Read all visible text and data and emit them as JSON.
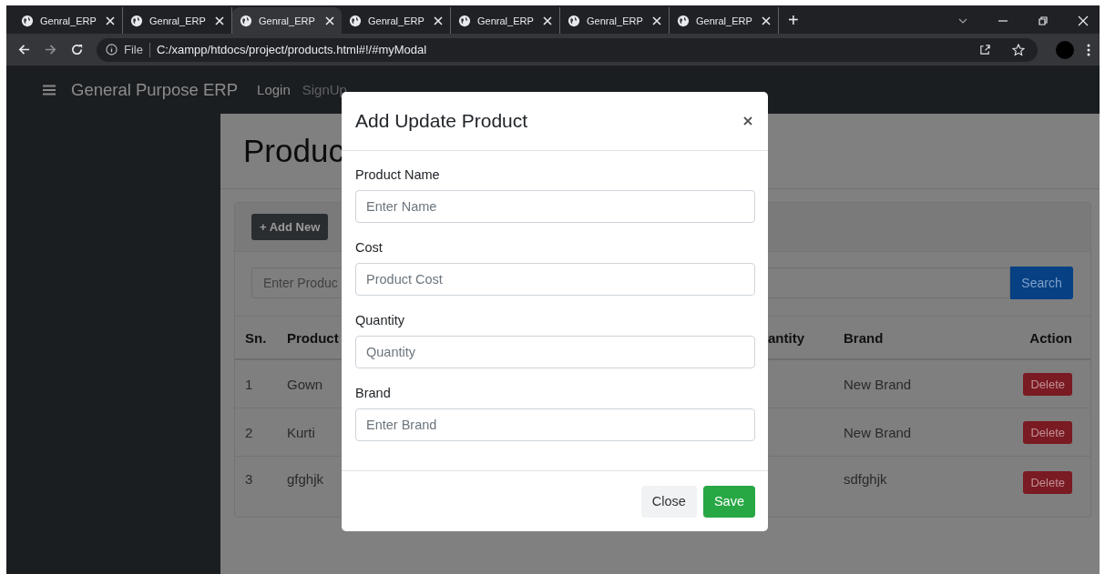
{
  "browser": {
    "tabs": [
      {
        "title": "Genral_ERP",
        "selected": false
      },
      {
        "title": "Genral_ERP",
        "selected": false
      },
      {
        "title": "Genral_ERP",
        "selected": true
      },
      {
        "title": "Genral_ERP",
        "selected": false
      },
      {
        "title": "Genral_ERP",
        "selected": false
      },
      {
        "title": "Genral_ERP",
        "selected": false
      },
      {
        "title": "Genral_ERP",
        "selected": false
      }
    ],
    "new_tab": "+",
    "address_bar": {
      "scheme": "File",
      "url": "C:/xampp/htdocs/project/products.html#!/#myModal"
    }
  },
  "navbar": {
    "brand": "General Purpose ERP",
    "links": [
      {
        "label": "Login",
        "active": true
      },
      {
        "label": "SignUp",
        "active": false
      }
    ]
  },
  "page": {
    "heading": "Produc",
    "add_button": "+ Add New",
    "search": {
      "placeholder": "Enter Produc",
      "button": "Search"
    },
    "table": {
      "columns": [
        "Sn.",
        "Product",
        "antity",
        "Brand",
        "Action"
      ],
      "rows": [
        {
          "sn": "1",
          "product": "Gown",
          "brand": "New Brand",
          "action": "Delete"
        },
        {
          "sn": "2",
          "product": "Kurti",
          "brand": "New Brand",
          "action": "Delete"
        },
        {
          "sn": "3",
          "product": "gfghjk",
          "brand": "sdfghjk",
          "action": "Delete"
        }
      ]
    }
  },
  "modal": {
    "title": "Add Update Product",
    "fields": [
      {
        "label": "Product Name",
        "placeholder": "Enter Name"
      },
      {
        "label": "Cost",
        "placeholder": "Product Cost"
      },
      {
        "label": "Quantity",
        "placeholder": "Quantity"
      },
      {
        "label": "Brand",
        "placeholder": "Enter Brand"
      }
    ],
    "buttons": [
      {
        "label": "Close",
        "kind": "secondary"
      },
      {
        "label": "Save",
        "kind": "primary"
      }
    ]
  }
}
